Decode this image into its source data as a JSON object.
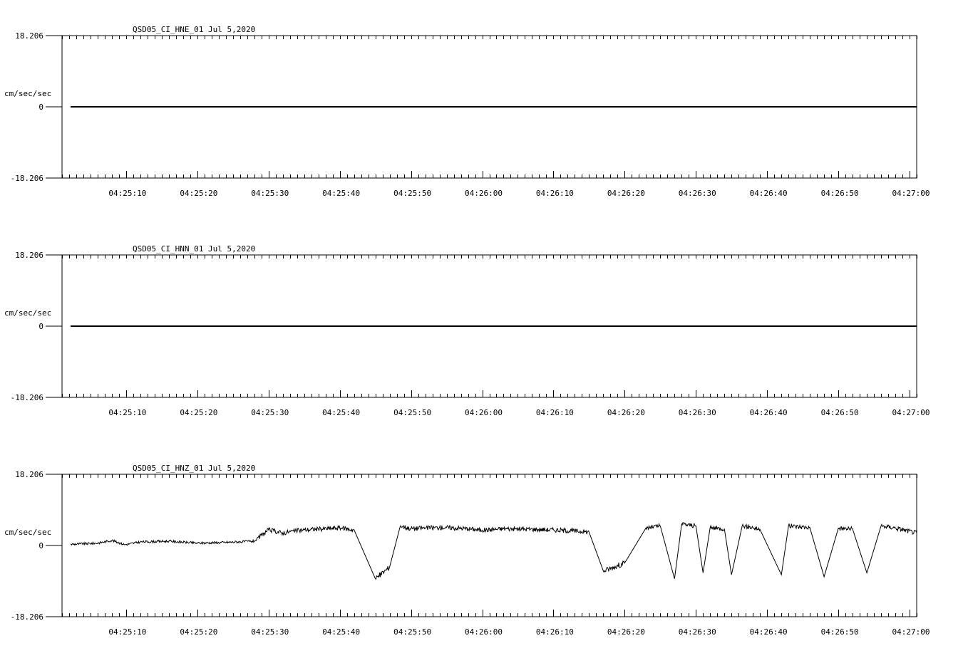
{
  "chart_data": [
    {
      "type": "line",
      "title": "QSD05_CI_HNE_01  Jul 5,2020",
      "ylabel": "cm/sec/sec",
      "ylim": [
        -18.206,
        18.206
      ],
      "yticks": [
        "18.206",
        "0",
        "-18.206"
      ],
      "xticks": [
        "04:25:10",
        "04:25:20",
        "04:25:30",
        "04:25:40",
        "04:25:50",
        "04:26:00",
        "04:26:10",
        "04:26:20",
        "04:26:30",
        "04:26:40",
        "04:26:50",
        "04:27:00"
      ],
      "xrange_seconds": [
        1.0,
        121.0
      ],
      "series": [
        {
          "x": [
            2.2,
            121.0
          ],
          "y": [
            0,
            0
          ]
        }
      ]
    },
    {
      "type": "line",
      "title": "QSD05_CI_HNN_01  Jul 5,2020",
      "ylabel": "cm/sec/sec",
      "ylim": [
        -18.206,
        18.206
      ],
      "yticks": [
        "18.206",
        "0",
        "-18.206"
      ],
      "xticks": [
        "04:25:10",
        "04:25:20",
        "04:25:30",
        "04:25:40",
        "04:25:50",
        "04:26:00",
        "04:26:10",
        "04:26:20",
        "04:26:30",
        "04:26:40",
        "04:26:50",
        "04:27:00"
      ],
      "xrange_seconds": [
        1.0,
        121.0
      ],
      "series": [
        {
          "x": [
            2.2,
            121.0
          ],
          "y": [
            0,
            0
          ]
        }
      ]
    },
    {
      "type": "line",
      "title": "QSD05_CI_HNZ_01  Jul 5,2020",
      "ylabel": "cm/sec/sec",
      "ylim": [
        -18.206,
        18.206
      ],
      "yticks": [
        "18.206",
        "0",
        "-18.206"
      ],
      "xticks": [
        "04:25:10",
        "04:25:20",
        "04:25:30",
        "04:25:40",
        "04:25:50",
        "04:26:00",
        "04:26:10",
        "04:26:20",
        "04:26:30",
        "04:26:40",
        "04:26:50",
        "04:27:00"
      ],
      "xrange_seconds": [
        1.0,
        121.0
      ],
      "series": [
        {
          "x": [
            2.2,
            6.0,
            8.0,
            9.8,
            12.0,
            16.0,
            20.0,
            24.0,
            28.0,
            30.0,
            32.0,
            33.5,
            35.0,
            37.0,
            40.0,
            42.0,
            45.0,
            47.0,
            48.5,
            50.0,
            52.0,
            55.0,
            58.0,
            60.0,
            63.0,
            66.0,
            70.0,
            74.0,
            75.0,
            77.0,
            80.0,
            83.0,
            85.0,
            87.0,
            88.0,
            90.0,
            91.0,
            92.0,
            94.0,
            95.0,
            96.5,
            98.0,
            99.0,
            102.0,
            103.0,
            106.0,
            108.0,
            110.0,
            112.0,
            114.0,
            116.0,
            118.0,
            121.0
          ],
          "y": [
            0.3,
            0.6,
            1.3,
            0.2,
            0.9,
            1.1,
            0.6,
            0.8,
            1.1,
            4.0,
            3.2,
            3.7,
            4.0,
            4.2,
            4.5,
            4.0,
            -8.5,
            -5.5,
            5.0,
            4.3,
            4.5,
            4.6,
            4.3,
            3.9,
            4.3,
            4.2,
            4.0,
            3.6,
            3.4,
            -6.5,
            -4.5,
            4.5,
            5.0,
            -8.5,
            5.5,
            5.0,
            -7.0,
            4.5,
            4.3,
            -7.5,
            5.0,
            4.6,
            4.1,
            -7.5,
            5.0,
            4.6,
            -8.0,
            4.4,
            4.2,
            -7.0,
            5.0,
            4.5,
            3.2
          ]
        }
      ]
    }
  ]
}
